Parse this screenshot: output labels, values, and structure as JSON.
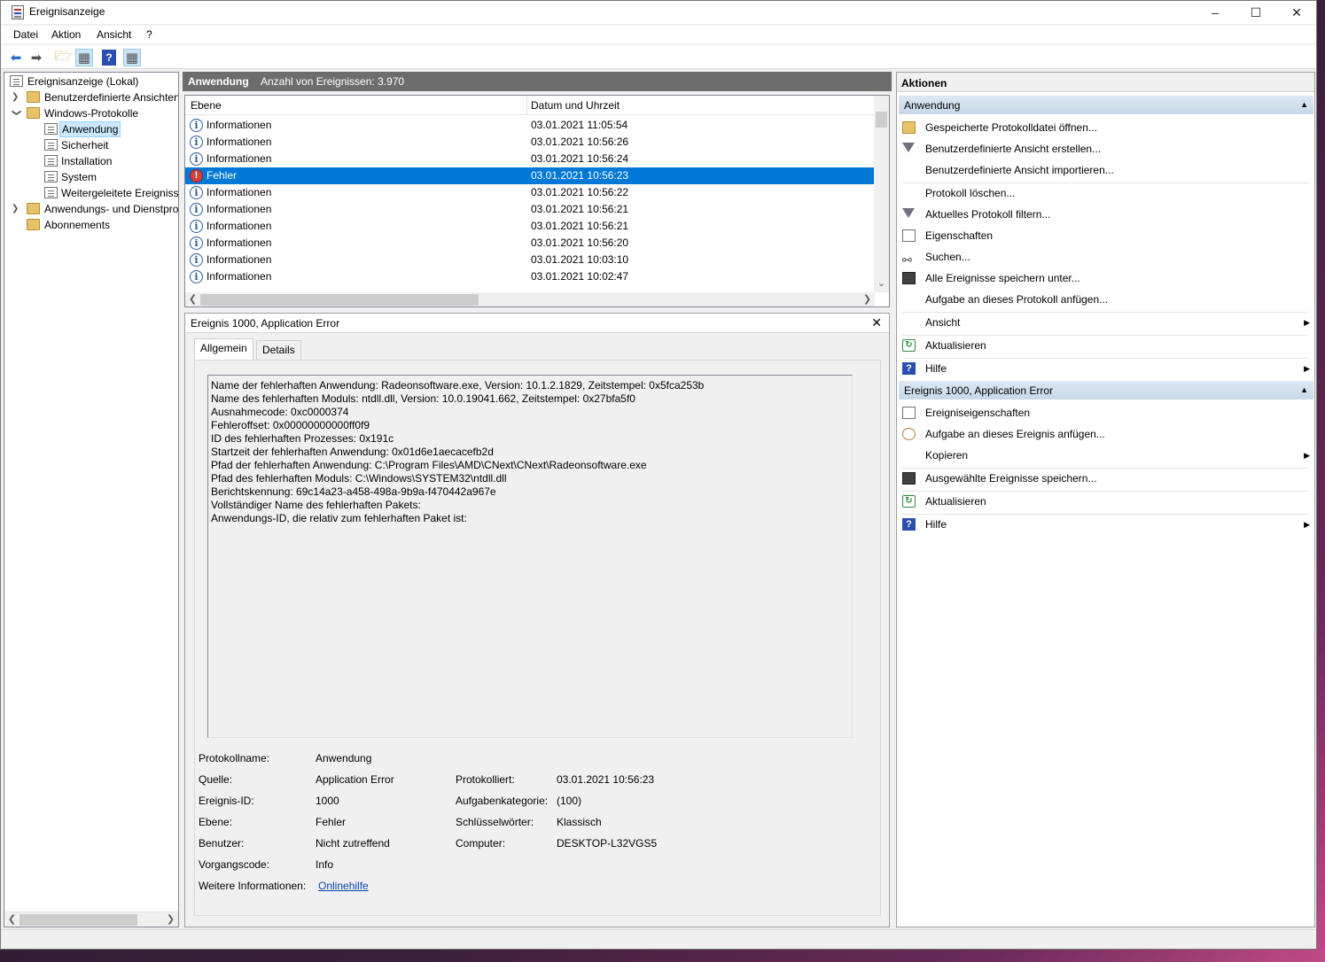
{
  "window": {
    "title": "Ereignisanzeige"
  },
  "menu": [
    "Datei",
    "Aktion",
    "Ansicht",
    "?"
  ],
  "tree": {
    "root": "Ereignisanzeige (Lokal)",
    "custom_views": "Benutzerdefinierte Ansichten",
    "windows_logs": "Windows-Protokolle",
    "logs": [
      "Anwendung",
      "Sicherheit",
      "Installation",
      "System",
      "Weitergeleitete Ereignisse"
    ],
    "app_service_logs": "Anwendungs- und Dienstprotokolle",
    "subscriptions": "Abonnements"
  },
  "events_header": {
    "title": "Anwendung",
    "count": "Anzahl von Ereignissen: 3.970"
  },
  "columns": {
    "level": "Ebene",
    "datetime": "Datum und Uhrzeit"
  },
  "events": [
    {
      "level": "Informationen",
      "datetime": "03.01.2021 11:05:54",
      "type": "info"
    },
    {
      "level": "Informationen",
      "datetime": "03.01.2021 10:56:26",
      "type": "info"
    },
    {
      "level": "Informationen",
      "datetime": "03.01.2021 10:56:24",
      "type": "info"
    },
    {
      "level": "Fehler",
      "datetime": "03.01.2021 10:56:23",
      "type": "error"
    },
    {
      "level": "Informationen",
      "datetime": "03.01.2021 10:56:22",
      "type": "info"
    },
    {
      "level": "Informationen",
      "datetime": "03.01.2021 10:56:21",
      "type": "info"
    },
    {
      "level": "Informationen",
      "datetime": "03.01.2021 10:56:21",
      "type": "info"
    },
    {
      "level": "Informationen",
      "datetime": "03.01.2021 10:56:20",
      "type": "info"
    },
    {
      "level": "Informationen",
      "datetime": "03.01.2021 10:03:10",
      "type": "info"
    },
    {
      "level": "Informationen",
      "datetime": "03.01.2021 10:02:47",
      "type": "info"
    }
  ],
  "detail": {
    "title": "Ereignis 1000, Application Error",
    "tabs": [
      "Allgemein",
      "Details"
    ],
    "description": [
      "Name der fehlerhaften Anwendung: Radeonsoftware.exe, Version: 10.1.2.1829, Zeitstempel: 0x5fca253b",
      "Name des fehlerhaften Moduls: ntdll.dll, Version: 10.0.19041.662, Zeitstempel: 0x27bfa5f0",
      "Ausnahmecode: 0xc0000374",
      "Fehleroffset: 0x00000000000ff0f9",
      "ID des fehlerhaften Prozesses: 0x191c",
      "Startzeit der fehlerhaften Anwendung: 0x01d6e1aecacefb2d",
      "Pfad der fehlerhaften Anwendung: C:\\Program Files\\AMD\\CNext\\CNext\\Radeonsoftware.exe",
      "Pfad des fehlerhaften Moduls: C:\\Windows\\SYSTEM32\\ntdll.dll",
      "Berichtskennung: 69c14a23-a458-498a-9b9a-f470442a967e",
      "Vollständiger Name des fehlerhaften Pakets:",
      "Anwendungs-ID, die relativ zum fehlerhaften Paket ist:"
    ],
    "labels": {
      "log_name": "Protokollname:",
      "source": "Quelle:",
      "event_id": "Ereignis-ID:",
      "level": "Ebene:",
      "user": "Benutzer:",
      "opcode": "Vorgangscode:",
      "more_info": "Weitere Informationen:",
      "logged": "Protokolliert:",
      "task_category": "Aufgabenkategorie:",
      "keywords": "Schlüsselwörter:",
      "computer": "Computer:"
    },
    "values": {
      "log_name": "Anwendung",
      "source": "Application Error",
      "event_id": "1000",
      "level": "Fehler",
      "user": "Nicht zutreffend",
      "opcode": "Info",
      "more_info": "Onlinehilfe",
      "logged": "03.01.2021 10:56:23",
      "task_category": "(100)",
      "keywords": "Klassisch",
      "computer": "DESKTOP-L32VGS5"
    }
  },
  "actions": {
    "header": "Aktionen",
    "section1": {
      "title": "Anwendung",
      "items": [
        {
          "label": "Gespeicherte Protokolldatei öffnen...",
          "icon": "folder-open-icon"
        },
        {
          "label": "Benutzerdefinierte Ansicht erstellen...",
          "icon": "filter-icon"
        },
        {
          "label": "Benutzerdefinierte Ansicht importieren...",
          "icon": ""
        },
        {
          "label": "Protokoll löschen...",
          "icon": ""
        },
        {
          "label": "Aktuelles Protokoll filtern...",
          "icon": "filter-icon"
        },
        {
          "label": "Eigenschaften",
          "icon": "properties-icon"
        },
        {
          "label": "Suchen...",
          "icon": "binoculars-icon"
        },
        {
          "label": "Alle Ereignisse speichern unter...",
          "icon": "save-icon"
        },
        {
          "label": "Aufgabe an dieses Protokoll anfügen...",
          "icon": ""
        },
        {
          "label": "Ansicht",
          "icon": "",
          "submenu": true
        },
        {
          "label": "Aktualisieren",
          "icon": "refresh-icon"
        },
        {
          "label": "Hilfe",
          "icon": "help-icon",
          "submenu": true
        }
      ]
    },
    "section2": {
      "title": "Ereignis 1000, Application Error",
      "items": [
        {
          "label": "Ereigniseigenschaften",
          "icon": "properties-icon"
        },
        {
          "label": "Aufgabe an dieses Ereignis anfügen...",
          "icon": "task-icon"
        },
        {
          "label": "Kopieren",
          "icon": "",
          "submenu": true
        },
        {
          "label": "Ausgewählte Ereignisse speichern...",
          "icon": "save-icon"
        },
        {
          "label": "Aktualisieren",
          "icon": "refresh-icon"
        },
        {
          "label": "Hilfe",
          "icon": "help-icon",
          "submenu": true
        }
      ]
    }
  }
}
